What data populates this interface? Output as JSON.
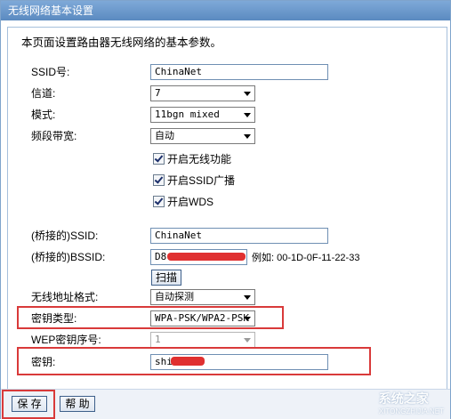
{
  "window": {
    "title": "无线网络基本设置"
  },
  "description": "本页面设置路由器无线网络的基本参数。",
  "fields": {
    "ssid": {
      "label": "SSID号:",
      "value": "ChinaNet"
    },
    "channel": {
      "label": "信道:",
      "value": "7"
    },
    "mode": {
      "label": "模式:",
      "value": "11bgn mixed"
    },
    "bandwidth": {
      "label": "频段带宽:",
      "value": "自动"
    },
    "bridge_ssid": {
      "label": "(桥接的)SSID:",
      "value": "ChinaNet"
    },
    "bridge_bssid": {
      "label": "(桥接的)BSSID:",
      "value": "D8-",
      "example": "例如: 00-1D-0F-11-22-33"
    },
    "address_format": {
      "label": "无线地址格式:",
      "value": "自动探测"
    },
    "key_type": {
      "label": "密钥类型:",
      "value": "WPA-PSK/WPA2-PSK"
    },
    "wep_index": {
      "label": "WEP密钥序号:",
      "value": "1"
    },
    "key": {
      "label": "密钥:",
      "value": "shi"
    }
  },
  "checkboxes": {
    "enable_wireless": "开启无线功能",
    "enable_ssid_broadcast": "开启SSID广播",
    "enable_wds": "开启WDS"
  },
  "buttons": {
    "scan": "扫描",
    "save": "保 存",
    "help": "帮 助"
  },
  "watermark": {
    "text": "系统之家",
    "url": "XITONGZHIJIA.NET"
  },
  "colors": {
    "highlight": "#d93a3a",
    "title_bar": "#6b97cc"
  }
}
